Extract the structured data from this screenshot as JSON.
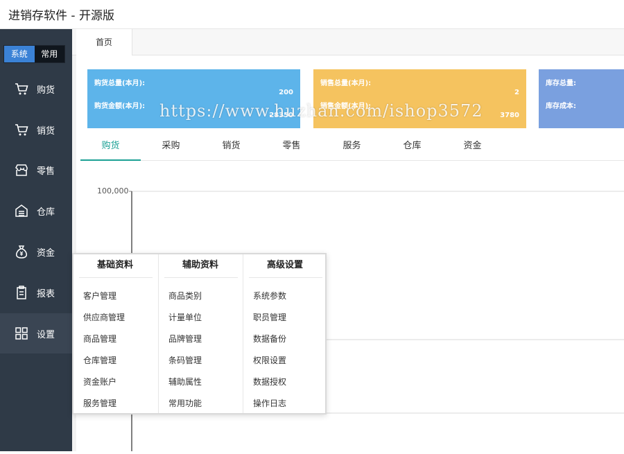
{
  "app": {
    "title": "进销存软件 - 开源版"
  },
  "sidebar": {
    "switch": {
      "system": "系统",
      "common": "常用"
    },
    "items": [
      {
        "label": "购货",
        "icon": "cart-icon"
      },
      {
        "label": "销货",
        "icon": "cart-icon"
      },
      {
        "label": "零售",
        "icon": "store-icon"
      },
      {
        "label": "仓库",
        "icon": "warehouse-icon"
      },
      {
        "label": "资金",
        "icon": "money-bag-icon"
      },
      {
        "label": "报表",
        "icon": "clipboard-icon"
      },
      {
        "label": "设置",
        "icon": "grid-icon"
      }
    ]
  },
  "tabs": {
    "home": "首页"
  },
  "cards": {
    "purchase": {
      "label1": "购货总量(本月):",
      "value1": "200",
      "label2": "购货金额(本月):",
      "value2": "28350"
    },
    "sales": {
      "label1": "销售总量(本月):",
      "value1": "2",
      "label2": "销售金额(本月):",
      "value2": "3780"
    },
    "stock": {
      "label1": "库存总量:",
      "label2": "库存成本:"
    }
  },
  "watermark": "https://www.huzhan.com/ishop3572",
  "subtabs": [
    "购货",
    "采购",
    "销货",
    "零售",
    "服务",
    "仓库",
    "资金"
  ],
  "chart_data": {
    "type": "line",
    "y_ticks": [
      "100,000"
    ]
  },
  "menu": {
    "columns": [
      {
        "title": "基础资料",
        "items": [
          "客户管理",
          "供应商管理",
          "商品管理",
          "仓库管理",
          "资金账户",
          "服务管理"
        ]
      },
      {
        "title": "辅助资料",
        "items": [
          "商品类别",
          "计量单位",
          "品牌管理",
          "条码管理",
          "辅助属性",
          "常用功能"
        ]
      },
      {
        "title": "高级设置",
        "items": [
          "系统参数",
          "职员管理",
          "数据备份",
          "权限设置",
          "数据授权",
          "操作日志"
        ]
      }
    ]
  },
  "colors": {
    "sidebar": "#2f3a47",
    "accent": "#1aa094",
    "card_blue": "#5db4ea",
    "card_yellow": "#f5c35f",
    "card_purple": "#7aa0df"
  }
}
